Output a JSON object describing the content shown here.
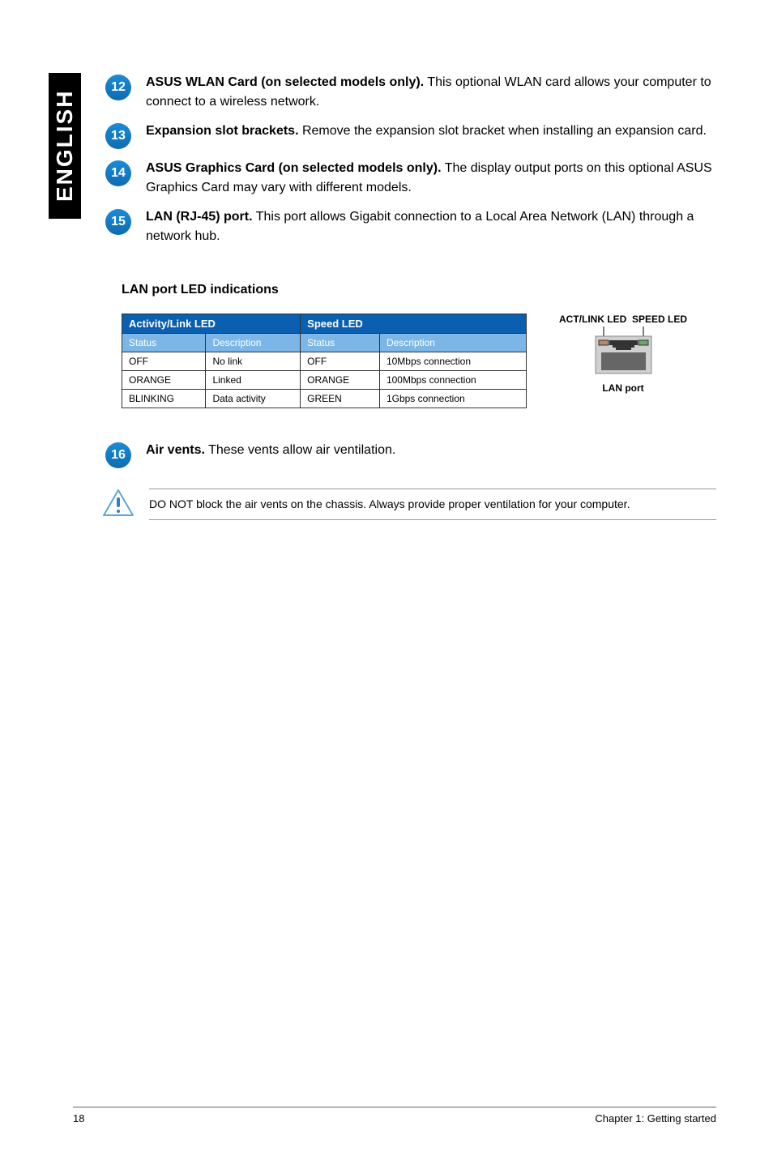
{
  "side_tab": "ENGLISH",
  "items": [
    {
      "num": "12",
      "bold": "ASUS WLAN Card (on selected models only).",
      "rest": " This optional WLAN card allows your computer to connect to a wireless network."
    },
    {
      "num": "13",
      "bold": "Expansion slot brackets.",
      "rest": " Remove the expansion slot bracket when installing an expansion card."
    },
    {
      "num": "14",
      "bold": "ASUS Graphics Card (on selected models only).",
      "rest": " The display output ports on this optional ASUS Graphics Card may vary with different models."
    },
    {
      "num": "15",
      "bold": "LAN (RJ-45) port.",
      "rest": " This port allows Gigabit connection to a Local Area Network (LAN) through a network hub."
    }
  ],
  "led": {
    "heading": "LAN port LED indications",
    "top_label1": "ACT/LINK LED",
    "top_label2": "SPEED LED",
    "port_caption": "LAN port",
    "header1": "Activity/Link LED",
    "header2": "Speed LED",
    "sub1": "Status",
    "sub2": "Description",
    "sub3": "Status",
    "sub4": "Description",
    "rows": [
      {
        "a": "OFF",
        "b": "No link",
        "c": "OFF",
        "d": "10Mbps connection"
      },
      {
        "a": "ORANGE",
        "b": "Linked",
        "c": "ORANGE",
        "d": "100Mbps connection"
      },
      {
        "a": "BLINKING",
        "b": "Data activity",
        "c": "GREEN",
        "d": "1Gbps connection"
      }
    ]
  },
  "item16": {
    "num": "16",
    "bold": "Air vents.",
    "rest": " These vents allow air ventilation."
  },
  "note": "DO NOT block the air vents on the chassis. Always provide proper ventilation for your computer.",
  "footer": {
    "page": "18",
    "chapter": "Chapter 1: Getting started"
  }
}
